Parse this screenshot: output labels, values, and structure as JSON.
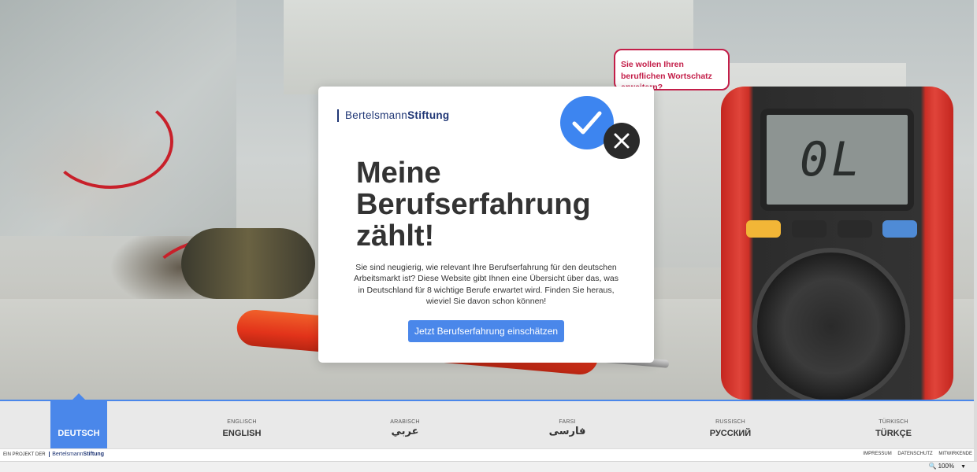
{
  "brand": {
    "name_light": "Bertelsmann",
    "name_bold": "Stiftung"
  },
  "bubble": {
    "text": "Sie wollen Ihren beruflichen Wortschatz erweitern?"
  },
  "meter": {
    "display": "0L"
  },
  "card": {
    "headline": "Meine Berufserfahrung zählt!",
    "description": "Sie sind neugierig, wie relevant Ihre Berufserfahrung für den deutschen Arbeitsmarkt ist? Diese Website gibt Ihnen eine Übersicht über das, was in Deutschland für 8 wichtige Berufe erwartet wird. Finden Sie heraus, wieviel Sie davon schon können!",
    "cta_label": "Jetzt Berufserfahrung einschätzen"
  },
  "languages": {
    "active": "DEUTSCH",
    "items": [
      {
        "sub": "ENGLISCH",
        "main": "ENGLISH"
      },
      {
        "sub": "ARABISCH",
        "main": "عربي"
      },
      {
        "sub": "FARSI",
        "main": "فارسی"
      },
      {
        "sub": "RUSSISCH",
        "main": "РУССКИЙ"
      },
      {
        "sub": "TÜRKISCH",
        "main": "TÜRKÇE"
      }
    ]
  },
  "footer": {
    "project_prefix": "EIN PROJEKT DER",
    "links": [
      "IMPRESSUM",
      "DATENSCHUTZ",
      "MITWIRKENDE"
    ]
  },
  "status": {
    "zoom": "100%"
  },
  "colors": {
    "accent": "#4a87ea",
    "brand": "#1f3675",
    "bubble": "#c31e49",
    "dark_icon": "#2a2a2a"
  }
}
